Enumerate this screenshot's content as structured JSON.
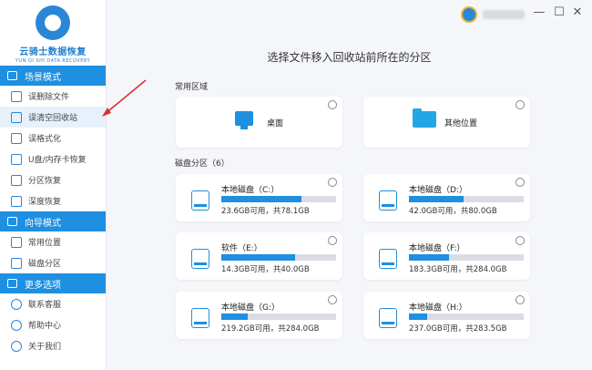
{
  "app": {
    "logo_title": "云骑士数据恢复",
    "logo_subtitle": "YUN QI SHI DATA RECOVERY"
  },
  "sidebar": {
    "sections": [
      {
        "title": "场景模式",
        "icon": "monitor-icon",
        "items": [
          {
            "label": "误删除文件",
            "icon": "file-icon"
          },
          {
            "label": "误清空回收站",
            "icon": "recycle-bin-icon",
            "active": true
          },
          {
            "label": "误格式化",
            "icon": "format-icon"
          },
          {
            "label": "U盘/内存卡恢复",
            "icon": "usb-icon"
          },
          {
            "label": "分区恢复",
            "icon": "partition-icon"
          },
          {
            "label": "深度恢复",
            "icon": "deep-scan-icon"
          }
        ]
      },
      {
        "title": "向导模式",
        "icon": "signpost-icon",
        "items": [
          {
            "label": "常用位置",
            "icon": "grid-icon"
          },
          {
            "label": "磁盘分区",
            "icon": "disk-icon"
          }
        ]
      },
      {
        "title": "更多选项",
        "icon": "menu-icon",
        "items": [
          {
            "label": "联系客服",
            "icon": "headset-icon"
          },
          {
            "label": "帮助中心",
            "icon": "help-icon"
          },
          {
            "label": "关于我们",
            "icon": "info-icon"
          }
        ]
      }
    ]
  },
  "titlebar": {
    "minimize": "—",
    "maximize": "☐",
    "close": "✕"
  },
  "main": {
    "title": "选择文件移入回收站前所在的分区",
    "common_label": "常用区域",
    "common": [
      {
        "label": "桌面",
        "icon": "desktop-icon"
      },
      {
        "label": "其他位置",
        "icon": "folder-icon"
      }
    ],
    "disk_label": "磁盘分区（6）",
    "drives": [
      {
        "name": "本地磁盘（C:）",
        "info": "23.6GB可用，共78.1GB",
        "used": 0.7
      },
      {
        "name": "本地磁盘（D:）",
        "info": "42.0GB可用，共80.0GB",
        "used": 0.48
      },
      {
        "name": "软件（E:）",
        "info": "14.3GB可用，共40.0GB",
        "used": 0.64
      },
      {
        "name": "本地磁盘（F:）",
        "info": "183.3GB可用，共284.0GB",
        "used": 0.35
      },
      {
        "name": "本地磁盘（G:）",
        "info": "219.2GB可用，共284.0GB",
        "used": 0.23
      },
      {
        "name": "本地磁盘（H:）",
        "info": "237.0GB可用，共283.5GB",
        "used": 0.16
      }
    ]
  },
  "colors": {
    "accent": "#1e8fe1",
    "annotation_arrow": "#d9312b"
  }
}
